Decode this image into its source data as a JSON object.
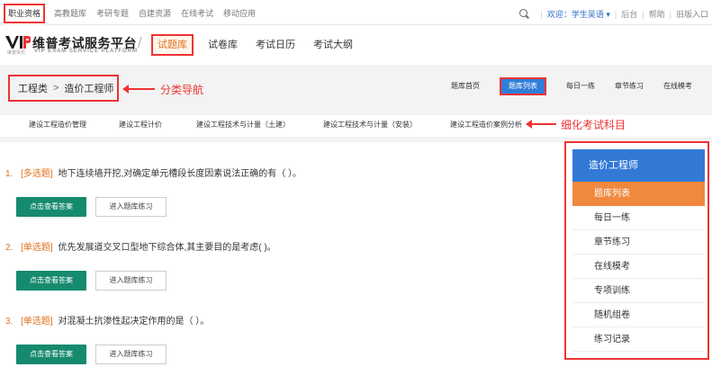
{
  "top": {
    "nav": [
      "职业资格",
      "高教题库",
      "考研专题",
      "自建资源",
      "在线考试",
      "移动应用"
    ],
    "welcome": "欢迎：学生吴语 ▾",
    "links": [
      "后台",
      "帮助",
      "旧版入口"
    ]
  },
  "header": {
    "logo_title": "维普考试服务平台",
    "logo_sub": "VIP EXAM SERVICE PLATFORM",
    "logo_brand": "维普资讯",
    "nav": [
      "试题库",
      "试卷库",
      "考试日历",
      "考试大纲"
    ]
  },
  "breadcrumb": {
    "root": "工程类",
    "sep": ">",
    "current": "造价工程师"
  },
  "annotations": {
    "category_nav": "分类导航",
    "subject_detail": "细化考试科目"
  },
  "subnav": [
    "题库首页",
    "题库列表",
    "每日一练",
    "章节练习",
    "在线模考"
  ],
  "subjects": [
    "建设工程造价管理",
    "建设工程计价",
    "建设工程技术与计量（土建）",
    "建设工程技术与计量（安装）",
    "建设工程造价案例分析"
  ],
  "questions": [
    {
      "num": "1.",
      "type": "[多选题]",
      "text": "地下连续墙开挖,对确定单元槽段长度因素说法正确的有（ ）。"
    },
    {
      "num": "2.",
      "type": "[单选题]",
      "text": "优先发展道交叉口型地下综合体,其主要目的是考虑( )。"
    },
    {
      "num": "3.",
      "type": "[单选题]",
      "text": "对混凝土抗渗性起决定作用的是（ ）。"
    }
  ],
  "buttons": {
    "answer": "点击查看答案",
    "practice": "进入题库练习"
  },
  "sidebar": {
    "title": "造价工程师",
    "items": [
      "题库列表",
      "每日一练",
      "章节练习",
      "在线模考",
      "专项训练",
      "随机组卷",
      "练习记录"
    ]
  },
  "colors": {
    "accent_red": "#e33",
    "primary_green": "#168a6f",
    "blue": "#3279d6",
    "orange": "#f0883e"
  }
}
